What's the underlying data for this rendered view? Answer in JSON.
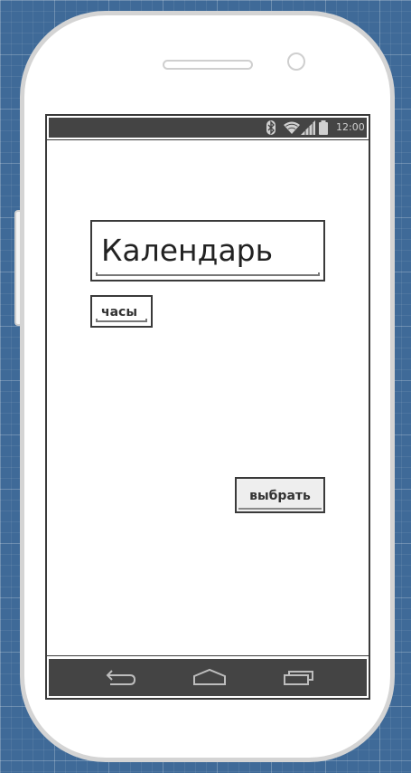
{
  "status_bar": {
    "time": "12:00",
    "icons": [
      "bluetooth-icon",
      "wifi-icon",
      "signal-icon",
      "battery-icon"
    ]
  },
  "main": {
    "title": "Календарь",
    "hours_field": "часы",
    "select_button": "выбрать"
  },
  "nav_bar": {
    "icons": [
      "back-icon",
      "home-icon",
      "recent-apps-icon"
    ]
  },
  "colors": {
    "background": "#3f6a98",
    "bars": "#444444",
    "outline": "#3a3a3a"
  }
}
